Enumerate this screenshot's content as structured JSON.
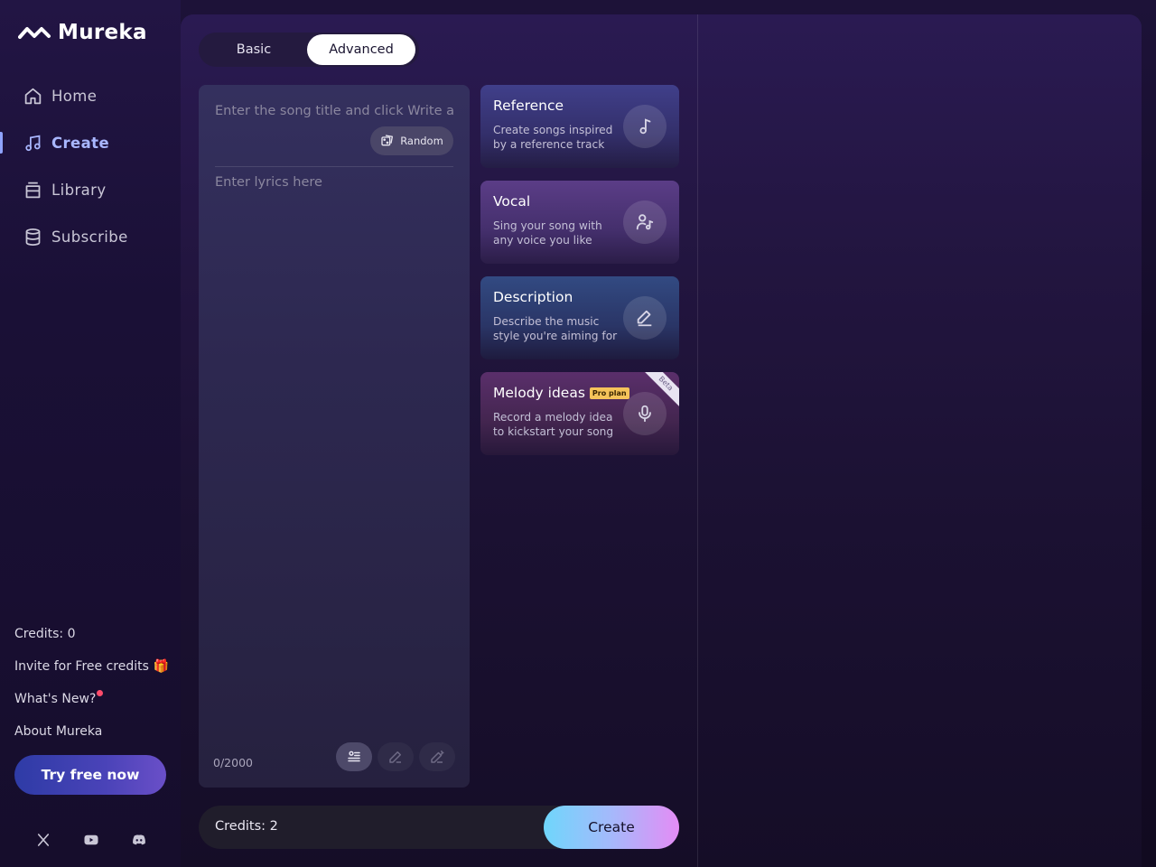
{
  "app": {
    "name": "Mureka"
  },
  "sidebar": {
    "items": [
      {
        "label": "Home",
        "icon": "home-icon",
        "active": false
      },
      {
        "label": "Create",
        "icon": "music-note-icon",
        "active": true
      },
      {
        "label": "Library",
        "icon": "library-icon",
        "active": false
      },
      {
        "label": "Subscribe",
        "icon": "database-icon",
        "active": false
      }
    ],
    "credits": "Credits: 0",
    "invite": "Invite for Free credits",
    "invite_icon": "🎁",
    "whats_new": "What's New?",
    "about": "About Mureka",
    "try_button": "Try free now",
    "socials": [
      "x-icon",
      "youtube-icon",
      "discord-icon"
    ]
  },
  "main": {
    "tabs": [
      {
        "label": "Basic",
        "active": false
      },
      {
        "label": "Advanced",
        "active": true
      }
    ],
    "editor": {
      "title_placeholder": "Enter the song title and click Write abc",
      "random_label": "Random",
      "lyrics_placeholder": "Enter lyrics here",
      "counter": "0/2000"
    },
    "cards": [
      {
        "title": "Reference",
        "desc": "Create songs inspired by a reference track",
        "icon": "music-note-icon"
      },
      {
        "title": "Vocal",
        "desc": "Sing your song with any voice you like",
        "icon": "voice-user-icon"
      },
      {
        "title": "Description",
        "desc": "Describe the music style you're aiming for",
        "icon": "pencil-icon"
      },
      {
        "title": "Melody ideas",
        "badge": "Pro plan",
        "ribbon": "Beta",
        "desc": "Record a melody idea to kickstart your song",
        "icon": "microphone-icon"
      }
    ],
    "bottom": {
      "credits": "Credits: 2",
      "create_label": "Create"
    }
  },
  "colors": {
    "accent": "#8fa3ff",
    "create_gradient_start": "#6fd6fb",
    "create_gradient_end": "#e48cf5",
    "try_button": "#2e3ba6"
  }
}
